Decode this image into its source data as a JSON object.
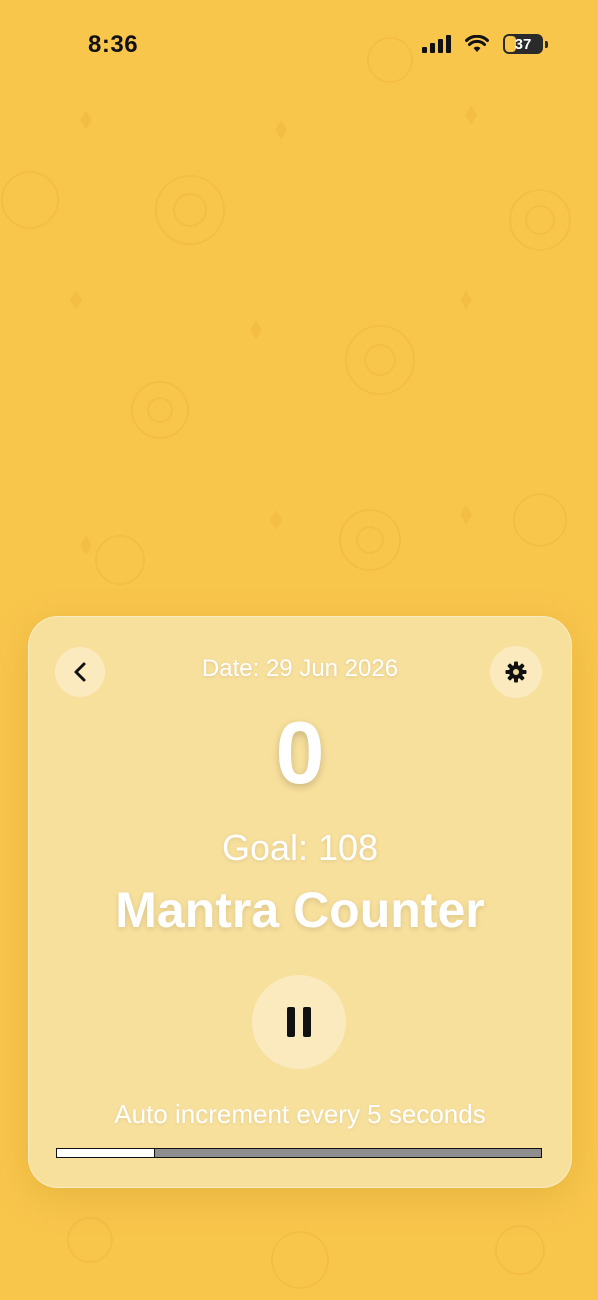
{
  "status_bar": {
    "time": "8:36",
    "battery_level": 37,
    "battery_text": "37",
    "icons": [
      "cellular-signal-icon",
      "wifi-icon",
      "battery-icon"
    ]
  },
  "colors": {
    "background": "#F9C64C",
    "card": "#F6E6B4",
    "text": "#FFFFFF",
    "progress_track": "#8E8E8E",
    "progress_fill": "#FFFFFF"
  },
  "counter": {
    "back_icon": "chevron-left-icon",
    "settings_icon": "gear-icon",
    "date_text": "Date: 29 Jun 2026",
    "count": "0",
    "goal_text": "Goal: 108",
    "title": "Mantra Counter",
    "pause_icon": "pause-icon",
    "auto_text": "Auto increment every 5 seconds",
    "progress_fraction": 0.2
  }
}
